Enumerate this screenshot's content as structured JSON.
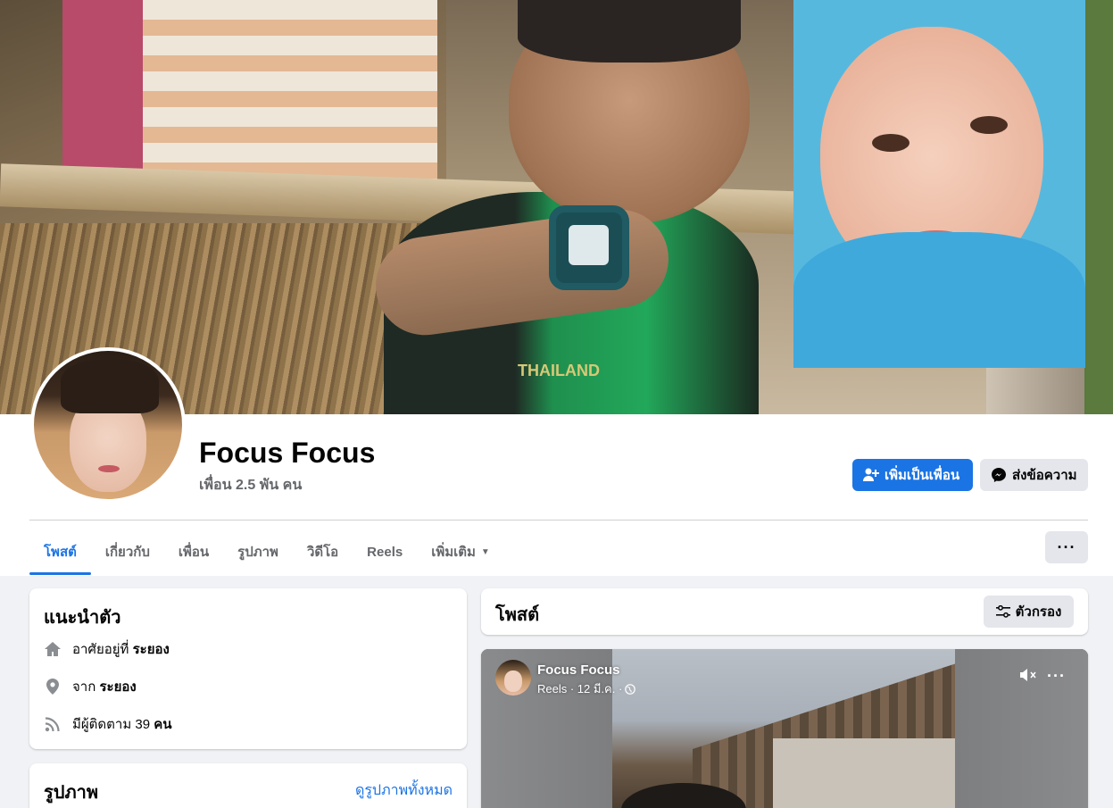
{
  "profile": {
    "name": "Focus Focus",
    "friends": "เพื่อน 2.5 พัน คน",
    "add_friend_label": "เพิ่มเป็นเพื่อน",
    "message_label": "ส่งข้อความ"
  },
  "cover": {
    "shirt_text": "THAILAND"
  },
  "tabs": [
    {
      "label": "โพสต์",
      "active": true
    },
    {
      "label": "เกี่ยวกับ"
    },
    {
      "label": "เพื่อน"
    },
    {
      "label": "รูปภาพ"
    },
    {
      "label": "วิดีโอ"
    },
    {
      "label": "Reels"
    },
    {
      "label": "เพิ่มเติม",
      "caret": "▼"
    }
  ],
  "more_label": "···",
  "intro": {
    "title": "แนะนำตัว",
    "lives_prefix": "อาศัยอยู่ที่",
    "lives_city": "ระยอง",
    "from_prefix": "จาก",
    "from_city": "ระยอง",
    "followers_prefix": "มีผู้ติดตาม",
    "followers_count": "39",
    "followers_suffix": "คน"
  },
  "photos": {
    "title": "รูปภาพ",
    "see_all": "ดูรูปภาพทั้งหมด"
  },
  "posts": {
    "title": "โพสต์",
    "filter_label": "ตัวกรอง"
  },
  "post": {
    "author": "Focus Focus",
    "meta": "Reels · 12 มี.ค. ·",
    "more_label": "···"
  },
  "colors": {
    "accent": "#1b74e4",
    "secondary_button": "#e4e6eb",
    "page_bg": "#f0f2f5"
  },
  "icons": {
    "add_friend": "person-plus-icon",
    "message": "messenger-icon",
    "home": "home-icon",
    "location": "location-pin-icon",
    "followers": "rss-icon",
    "filter": "sliders-icon",
    "globe": "globe-icon",
    "mute": "speaker-muted-icon"
  }
}
